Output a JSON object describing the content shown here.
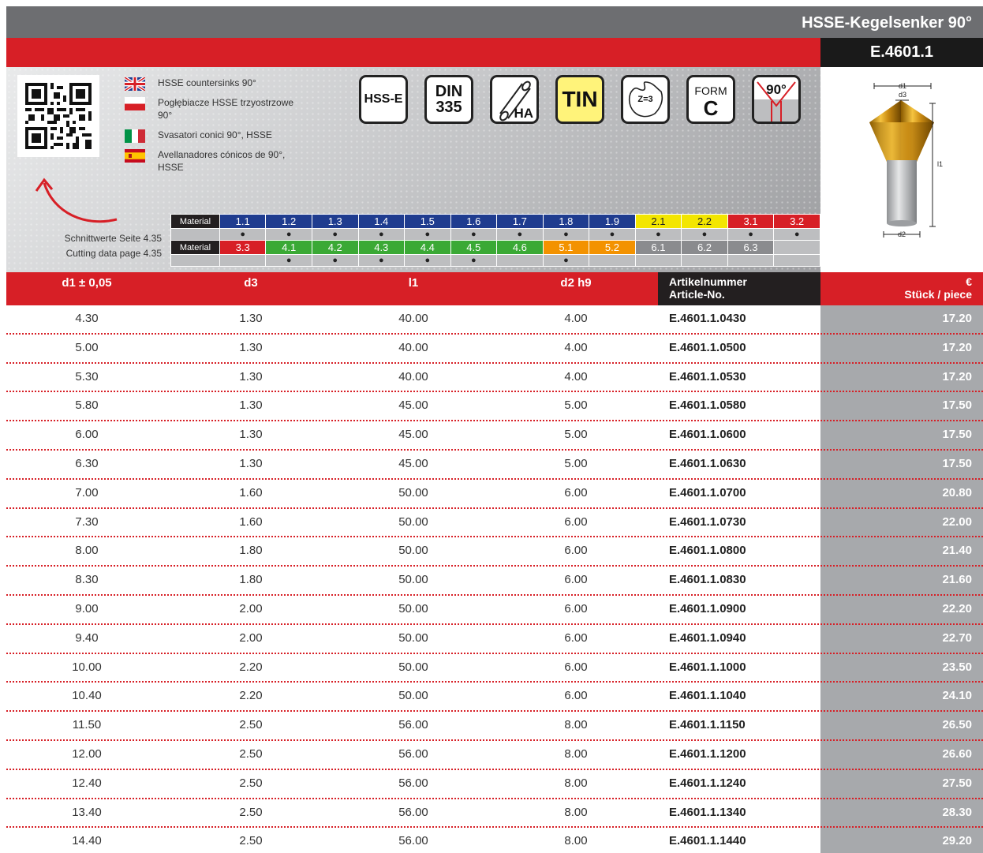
{
  "header": {
    "title": "HSSE-Kegelsenker 90°",
    "code": "E.4601.1"
  },
  "languages": [
    {
      "flag": "uk-flag-icon",
      "text": "HSSE countersinks 90°"
    },
    {
      "flag": "pl-flag-icon",
      "text": "Pogłębiacze HSSE trzyostrzowe 90°"
    },
    {
      "flag": "it-flag-icon",
      "text": "Svasatori conici 90°, HSSE"
    },
    {
      "flag": "es-flag-icon",
      "text": "Avellanadores cónicos de 90°, HSSE"
    }
  ],
  "badges": {
    "hsse": "HSS-E",
    "din_top": "DIN",
    "din_bottom": "335",
    "ha": "HA",
    "tin": "TIN",
    "z": "Z=3",
    "form_top": "FORM",
    "form_bottom": "C",
    "angle": "90°"
  },
  "cutting": {
    "line1": "Schnittwerte Seite 4.35",
    "line2": "Cutting data page 4.35"
  },
  "material": {
    "label": "Material",
    "row1": [
      {
        "code": "1.1",
        "color": "#1f3c8f",
        "dot": "●"
      },
      {
        "code": "1.2",
        "color": "#1f3c8f",
        "dot": "●"
      },
      {
        "code": "1.3",
        "color": "#1f3c8f",
        "dot": "●"
      },
      {
        "code": "1.4",
        "color": "#1f3c8f",
        "dot": "●"
      },
      {
        "code": "1.5",
        "color": "#1f3c8f",
        "dot": "●"
      },
      {
        "code": "1.6",
        "color": "#1f3c8f",
        "dot": "●"
      },
      {
        "code": "1.7",
        "color": "#1f3c8f",
        "dot": "●"
      },
      {
        "code": "1.8",
        "color": "#1f3c8f",
        "dot": "●"
      },
      {
        "code": "1.9",
        "color": "#1f3c8f",
        "dot": "●"
      },
      {
        "code": "2.1",
        "color": "#f3e600",
        "dot": "●"
      },
      {
        "code": "2.2",
        "color": "#f3e600",
        "dot": "●"
      },
      {
        "code": "3.1",
        "color": "#d71f26",
        "dot": "●"
      },
      {
        "code": "3.2",
        "color": "#d71f26",
        "dot": "●"
      }
    ],
    "row2": [
      {
        "code": "3.3",
        "color": "#d71f26",
        "dot": ""
      },
      {
        "code": "4.1",
        "color": "#3aa935",
        "dot": "●"
      },
      {
        "code": "4.2",
        "color": "#3aa935",
        "dot": "●"
      },
      {
        "code": "4.3",
        "color": "#3aa935",
        "dot": "●"
      },
      {
        "code": "4.4",
        "color": "#3aa935",
        "dot": "●"
      },
      {
        "code": "4.5",
        "color": "#3aa935",
        "dot": "●"
      },
      {
        "code": "4.6",
        "color": "#3aa935",
        "dot": ""
      },
      {
        "code": "5.1",
        "color": "#f39200",
        "dot": "●"
      },
      {
        "code": "5.2",
        "color": "#f39200",
        "dot": ""
      },
      {
        "code": "6.1",
        "color": "#8a8b8e",
        "dot": ""
      },
      {
        "code": "6.2",
        "color": "#8a8b8e",
        "dot": ""
      },
      {
        "code": "6.3",
        "color": "#8a8b8e",
        "dot": ""
      },
      {
        "code": "",
        "color": "#bdbec0",
        "dot": ""
      }
    ]
  },
  "product_labels": {
    "d1": "d1",
    "d3": "d3",
    "l1": "l1",
    "d2": "d2"
  },
  "table": {
    "headers": {
      "d1": "d1 ± 0,05",
      "d3": "d3",
      "l1": "l1",
      "d2": "d2 h9",
      "art_line1": "Artikelnummer",
      "art_line2": "Article-No.",
      "price_line1": "€",
      "price_line2": "Stück / piece"
    },
    "rows": [
      {
        "d1": "4.30",
        "d3": "1.30",
        "l1": "40.00",
        "d2": "4.00",
        "art": "E.4601.1.0430",
        "price": "17.20"
      },
      {
        "d1": "5.00",
        "d3": "1.30",
        "l1": "40.00",
        "d2": "4.00",
        "art": "E.4601.1.0500",
        "price": "17.20"
      },
      {
        "d1": "5.30",
        "d3": "1.30",
        "l1": "40.00",
        "d2": "4.00",
        "art": "E.4601.1.0530",
        "price": "17.20"
      },
      {
        "d1": "5.80",
        "d3": "1.30",
        "l1": "45.00",
        "d2": "5.00",
        "art": "E.4601.1.0580",
        "price": "17.50"
      },
      {
        "d1": "6.00",
        "d3": "1.30",
        "l1": "45.00",
        "d2": "5.00",
        "art": "E.4601.1.0600",
        "price": "17.50"
      },
      {
        "d1": "6.30",
        "d3": "1.30",
        "l1": "45.00",
        "d2": "5.00",
        "art": "E.4601.1.0630",
        "price": "17.50"
      },
      {
        "d1": "7.00",
        "d3": "1.60",
        "l1": "50.00",
        "d2": "6.00",
        "art": "E.4601.1.0700",
        "price": "20.80"
      },
      {
        "d1": "7.30",
        "d3": "1.60",
        "l1": "50.00",
        "d2": "6.00",
        "art": "E.4601.1.0730",
        "price": "22.00"
      },
      {
        "d1": "8.00",
        "d3": "1.80",
        "l1": "50.00",
        "d2": "6.00",
        "art": "E.4601.1.0800",
        "price": "21.40"
      },
      {
        "d1": "8.30",
        "d3": "1.80",
        "l1": "50.00",
        "d2": "6.00",
        "art": "E.4601.1.0830",
        "price": "21.60"
      },
      {
        "d1": "9.00",
        "d3": "2.00",
        "l1": "50.00",
        "d2": "6.00",
        "art": "E.4601.1.0900",
        "price": "22.20"
      },
      {
        "d1": "9.40",
        "d3": "2.00",
        "l1": "50.00",
        "d2": "6.00",
        "art": "E.4601.1.0940",
        "price": "22.70"
      },
      {
        "d1": "10.00",
        "d3": "2.20",
        "l1": "50.00",
        "d2": "6.00",
        "art": "E.4601.1.1000",
        "price": "23.50"
      },
      {
        "d1": "10.40",
        "d3": "2.20",
        "l1": "50.00",
        "d2": "6.00",
        "art": "E.4601.1.1040",
        "price": "24.10"
      },
      {
        "d1": "11.50",
        "d3": "2.50",
        "l1": "56.00",
        "d2": "8.00",
        "art": "E.4601.1.1150",
        "price": "26.50"
      },
      {
        "d1": "12.00",
        "d3": "2.50",
        "l1": "56.00",
        "d2": "8.00",
        "art": "E.4601.1.1200",
        "price": "26.60"
      },
      {
        "d1": "12.40",
        "d3": "2.50",
        "l1": "56.00",
        "d2": "8.00",
        "art": "E.4601.1.1240",
        "price": "27.50"
      },
      {
        "d1": "13.40",
        "d3": "2.50",
        "l1": "56.00",
        "d2": "8.00",
        "art": "E.4601.1.1340",
        "price": "28.30"
      },
      {
        "d1": "14.40",
        "d3": "2.50",
        "l1": "56.00",
        "d2": "8.00",
        "art": "E.4601.1.1440",
        "price": "29.20"
      }
    ]
  }
}
